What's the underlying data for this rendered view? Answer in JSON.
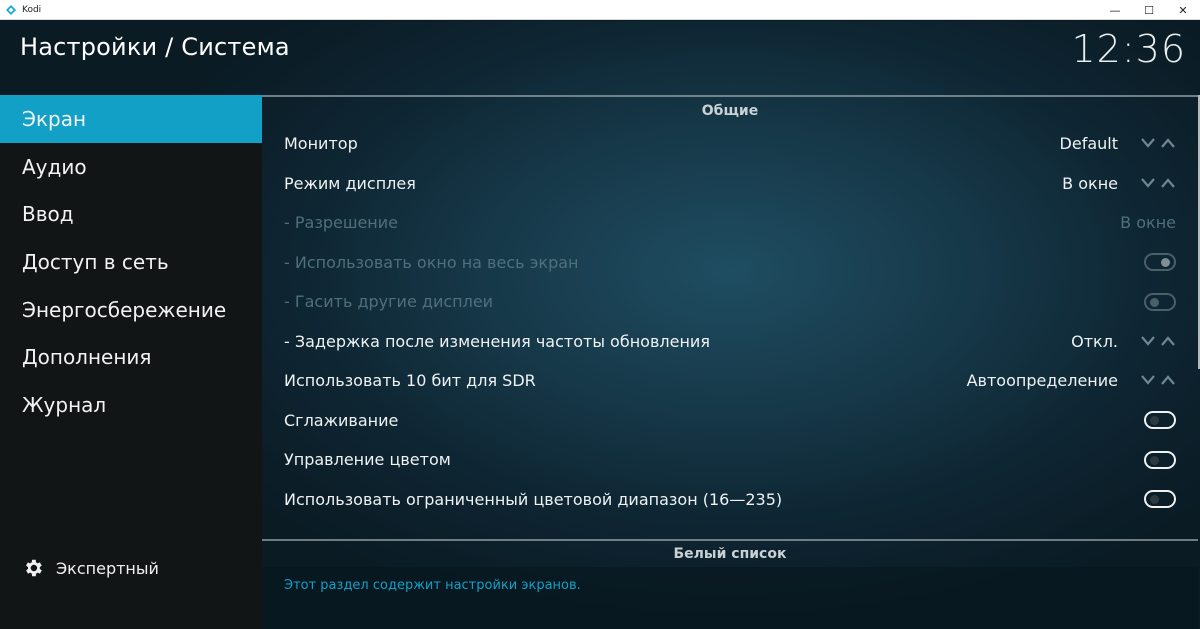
{
  "window": {
    "title": "Kodi",
    "controls": [
      "—",
      "☐",
      "✕"
    ]
  },
  "header": {
    "title": "Настройки / Система",
    "clock": "12:36"
  },
  "sidebar": {
    "items": [
      {
        "label": "Экран",
        "active": true
      },
      {
        "label": "Аудио"
      },
      {
        "label": "Ввод"
      },
      {
        "label": "Доступ в сеть"
      },
      {
        "label": "Энергосбережение"
      },
      {
        "label": "Дополнения"
      },
      {
        "label": "Журнал"
      }
    ],
    "level": "Экспертный"
  },
  "main": {
    "section_general": "Общие",
    "settings": [
      {
        "label": "Монитор",
        "value": "Default",
        "control": "spinner"
      },
      {
        "label": "Режим дисплея",
        "value": "В окне",
        "control": "spinner"
      },
      {
        "label": "- Разрешение",
        "value": "В окне",
        "control": "text",
        "disabled": true
      },
      {
        "label": "- Использовать окно на весь экран",
        "control": "toggle",
        "state": "on",
        "disabled": true
      },
      {
        "label": "- Гасить другие дисплеи",
        "control": "toggle",
        "state": "off",
        "disabled": true
      },
      {
        "label": "- Задержка после изменения частоты обновления",
        "value": "Откл.",
        "control": "spinner"
      },
      {
        "label": "Использовать 10 бит для SDR",
        "value": "Автоопределение",
        "control": "spinner"
      },
      {
        "label": "Сглаживание",
        "control": "toggle",
        "state": "off"
      },
      {
        "label": "Управление цветом",
        "control": "toggle",
        "state": "off"
      },
      {
        "label": "Использовать ограниченный цветовой диапазон (16—235)",
        "control": "toggle",
        "state": "off"
      }
    ],
    "section_whitelist": "Белый список",
    "description": "Этот раздел содержит настройки экранов."
  },
  "colors": {
    "accent": "#12a0c7",
    "sidebar_bg": "#121516",
    "text": "#eef2f3",
    "disabled_text": "#4f6f7d"
  }
}
